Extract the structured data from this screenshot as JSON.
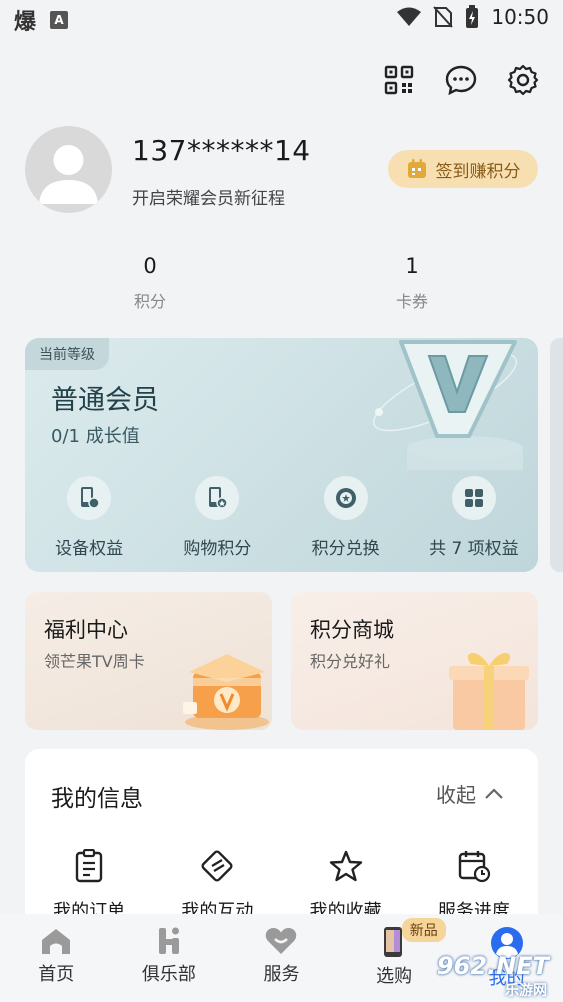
{
  "status_bar": {
    "app_glyph": "爆",
    "a_icon": "A",
    "time": "10:50"
  },
  "header": {
    "icons": [
      "qr-code-icon",
      "message-icon",
      "settings-icon"
    ]
  },
  "profile": {
    "username": "137******14",
    "subtitle": "开启荣耀会员新征程",
    "signin_label": "签到赚积分"
  },
  "stats": [
    {
      "value": "0",
      "label": "积分"
    },
    {
      "value": "1",
      "label": "卡券"
    }
  ],
  "membership": {
    "tag": "当前等级",
    "level_name": "普通会员",
    "growth": "0/1 成长值",
    "benefits": [
      {
        "label": "设备权益",
        "icon": "device-icon"
      },
      {
        "label": "购物积分",
        "icon": "shopping-points-icon"
      },
      {
        "label": "积分兑换",
        "icon": "points-exchange-icon"
      },
      {
        "label": "共 7 项权益",
        "icon": "grid-icon"
      }
    ]
  },
  "promos": {
    "welfare": {
      "title": "福利中心",
      "subtitle": "领芒果TV周卡"
    },
    "mall": {
      "title": "积分商城",
      "subtitle": "积分兑好礼"
    }
  },
  "my_info": {
    "title": "我的信息",
    "collapse_label": "收起",
    "items": [
      {
        "label": "我的订单",
        "icon": "order-icon"
      },
      {
        "label": "我的互动",
        "icon": "interaction-icon"
      },
      {
        "label": "我的收藏",
        "icon": "star-icon"
      },
      {
        "label": "服务进度",
        "icon": "calendar-clock-icon"
      }
    ]
  },
  "tab_bar": {
    "tabs": [
      {
        "label": "首页",
        "icon": "home-icon"
      },
      {
        "label": "俱乐部",
        "icon": "club-icon"
      },
      {
        "label": "服务",
        "icon": "heart-icon"
      },
      {
        "label": "选购",
        "icon": "phone-icon",
        "badge": "新品"
      },
      {
        "label": "我的",
        "icon": "person-icon"
      }
    ]
  },
  "watermark": {
    "text": "962.NET",
    "subtext": "乐游网"
  },
  "colors": {
    "accent": "#2a6cf0",
    "signin_bg": "#f7dfb2",
    "signin_text": "#8a5b16",
    "member_card": "#cfe2e5"
  }
}
